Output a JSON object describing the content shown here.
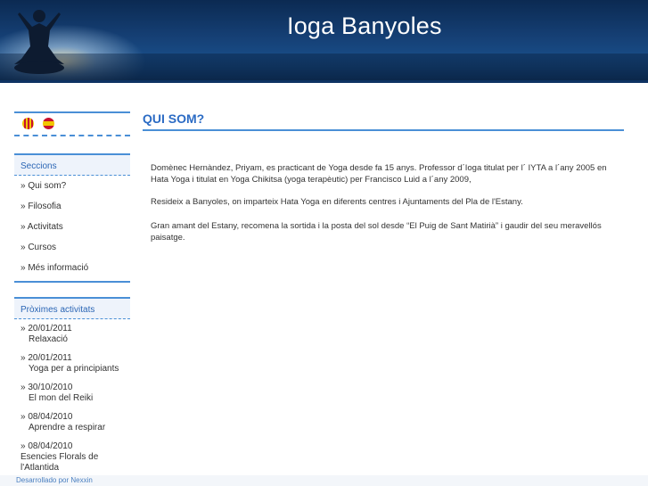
{
  "header": {
    "title": "Ioga Banyoles"
  },
  "languages": [
    {
      "name": "català",
      "icon": "catalan-flag-icon"
    },
    {
      "name": "español",
      "icon": "spain-flag-icon"
    }
  ],
  "sections": {
    "title": "Seccions",
    "items": [
      {
        "label": "» Qui som?"
      },
      {
        "label": "» Filosofia"
      },
      {
        "label": "» Activitats"
      },
      {
        "label": "» Cursos"
      },
      {
        "label": "» Més informació"
      }
    ]
  },
  "activities": {
    "title": "Pròximes activitats",
    "items": [
      {
        "date": "» 20/01/2011",
        "desc": "Relaxació"
      },
      {
        "date": "» 20/01/2011",
        "desc": "Yoga per a principiants"
      },
      {
        "date": "» 30/10/2010",
        "desc": "El mon del Reiki"
      },
      {
        "date": "» 08/04/2010",
        "desc": "Aprendre a respirar"
      },
      {
        "date": "» 08/04/2010",
        "desc": "Esencies Florals de l'Atlantida"
      }
    ]
  },
  "main": {
    "title": "QUI SOM?",
    "paragraphs": [
      "Domènec Hernàndez, Priyam, es practicant de Yoga desde fa 15 anys. Professor d´Ioga titulat per l´ IYTA a l´any 2005 en Hata Yoga i titulat en Yoga Chikitsa (yoga terapèutic) per Francisco Luid a l´any 2009,",
      "Resideix a Banyoles, on imparteix Hata Yoga en diferents centres i Ajuntaments del Pla de l'Estany.",
      "Gran amant del Estany, recomena la sortida i la posta del sol desde “El Puig de Sant Matirià” i gaudir del seu meravellós paisatge."
    ]
  },
  "footer": {
    "credit": "Desarrollado por Nexxin"
  }
}
